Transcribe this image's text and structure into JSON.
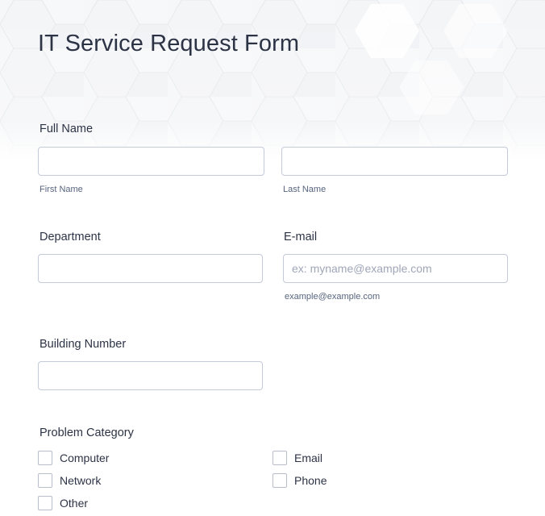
{
  "form": {
    "title": "IT Service Request Form"
  },
  "full_name": {
    "label": "Full Name",
    "first_value": "",
    "first_sublabel": "First Name",
    "last_value": "",
    "last_sublabel": "Last Name"
  },
  "department": {
    "label": "Department",
    "value": ""
  },
  "email": {
    "label": "E-mail",
    "value": "",
    "placeholder": "ex: myname@example.com",
    "sublabel": "example@example.com"
  },
  "building": {
    "label": "Building Number",
    "value": ""
  },
  "problem_category": {
    "label": "Problem Category",
    "options": [
      {
        "label": "Computer",
        "checked": false
      },
      {
        "label": "Email",
        "checked": false
      },
      {
        "label": "Network",
        "checked": false
      },
      {
        "label": "Phone",
        "checked": false
      },
      {
        "label": "Other",
        "checked": false
      }
    ]
  },
  "colors": {
    "text": "#2c3345",
    "input_border": "#c3cad8",
    "placeholder": "#a0a6b8",
    "sublabel": "#57647e",
    "background": "#ffffff"
  }
}
